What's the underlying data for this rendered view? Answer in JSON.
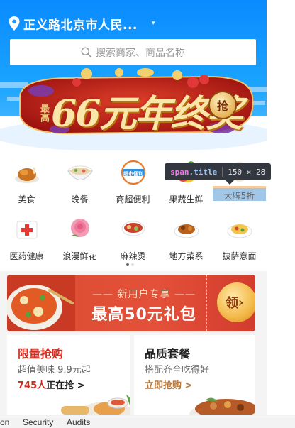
{
  "header": {
    "location": "正义路北京市人民...",
    "location_caret": "▾",
    "search_placeholder": "搜索商家、商品名称"
  },
  "banner": {
    "prefix": "最高",
    "title": "66元年终奖",
    "badge": "抢"
  },
  "categories": [
    {
      "label": "美食",
      "icon": "roast-chicken-icon"
    },
    {
      "label": "晚餐",
      "icon": "noodle-bowl-icon"
    },
    {
      "label": "商超便利",
      "icon": "supermarket-icon",
      "badge": "超市便利"
    },
    {
      "label": "果蔬生鲜",
      "icon": "fruit-icon"
    },
    {
      "label": "大牌5折",
      "icon": "brand-discount-icon"
    },
    {
      "label": "医药健康",
      "icon": "medicine-box-icon"
    },
    {
      "label": "浪漫鲜花",
      "icon": "rose-icon"
    },
    {
      "label": "麻辣烫",
      "icon": "spicy-hotpot-icon"
    },
    {
      "label": "地方菜系",
      "icon": "local-dish-icon"
    },
    {
      "label": "披萨意面",
      "icon": "pizza-pasta-icon"
    }
  ],
  "pager": {
    "count": 2,
    "active": 0
  },
  "inspector": {
    "tag": "span",
    "class_name": ".title",
    "dims": "150 × 28"
  },
  "promo": {
    "subtitle": "新用户专享",
    "title": "最高50元礼包",
    "receive": "领"
  },
  "cards": [
    {
      "title": "限量抢购",
      "desc": "超值美味 9.9元起",
      "count": "745人",
      "count_suffix": "正在抢 >",
      "title_color": "#d12b1e",
      "cta_color": "#d12b1e"
    },
    {
      "title": "品质套餐",
      "desc": "搭配齐全吃得好",
      "cta": "立即抢购 >",
      "title_color": "#222222",
      "cta_color": "#b5773b"
    }
  ],
  "devtools": {
    "tabs": [
      "on",
      "Security",
      "Audits"
    ]
  },
  "colors": {
    "brand_blue": "#0a8bff",
    "promo_red": "#e4513a",
    "hot_red": "#d12b1e",
    "gold": "#e6b257"
  }
}
